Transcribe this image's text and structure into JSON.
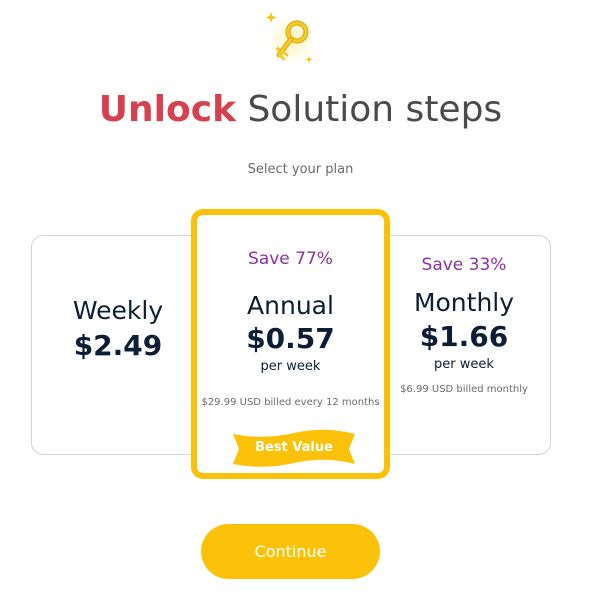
{
  "header": {
    "icon": "key-icon",
    "title_highlight": "Unlock",
    "title_rest": " Solution steps",
    "subtitle": "Select your plan"
  },
  "plans": {
    "weekly": {
      "name": "Weekly",
      "price": "$2.49"
    },
    "annual": {
      "save": "Save 77%",
      "name": "Annual",
      "price": "$0.57",
      "per": "per week",
      "billed": "$29.99 USD billed every 12 months",
      "badge": "Best Value",
      "selected": true
    },
    "monthly": {
      "save": "Save 33%",
      "name": "Monthly",
      "price": "$1.66",
      "per": "per week",
      "billed": "$6.99 USD billed monthly"
    }
  },
  "actions": {
    "continue_label": "Continue"
  },
  "colors": {
    "accent": "#fcc20a",
    "highlight": "#d7404f",
    "save_text": "#8e2fa5",
    "text_dark": "#0c1e36"
  }
}
